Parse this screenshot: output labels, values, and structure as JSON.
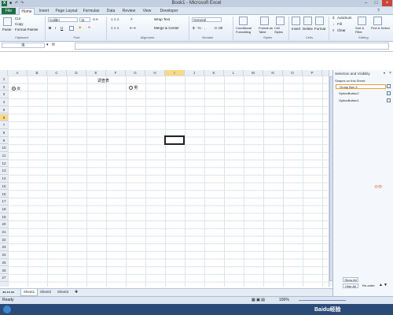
{
  "window": {
    "title": "Book1 - Microsoft Excel"
  },
  "tabs": [
    "File",
    "Home",
    "Insert",
    "Page Layout",
    "Formulas",
    "Data",
    "Review",
    "View",
    "Developer"
  ],
  "ribbon": {
    "clipboard": {
      "paste": "Paste",
      "cut": "Cut",
      "copy": "Copy",
      "format_painter": "Format Painter",
      "label": "Clipboard"
    },
    "font": {
      "name": "Calibri",
      "size": "11",
      "label": "Font"
    },
    "alignment": {
      "wrap": "Wrap Text",
      "merge": "Merge & Center",
      "label": "Alignment"
    },
    "number": {
      "format": "General",
      "label": "Number"
    },
    "styles": {
      "conditional": "Conditional Formatting",
      "table": "Format as Table",
      "cell_styles": "Cell Styles",
      "label": "Styles"
    },
    "cells": {
      "insert": "Insert",
      "delete": "Delete",
      "format": "Format",
      "label": "Cells"
    },
    "editing": {
      "autosum": "AutoSum",
      "fill": "Fill",
      "clear": "Clear",
      "sort": "Sort & Filter",
      "find": "Find & Select",
      "label": "Editing"
    }
  },
  "formula_bar": {
    "name_box": "I6",
    "fx": "fx",
    "value": ""
  },
  "columns": [
    "A",
    "B",
    "C",
    "D",
    "E",
    "F",
    "G",
    "H",
    "I",
    "J",
    "K",
    "L",
    "M",
    "N",
    "O",
    "P"
  ],
  "rows": [
    "1",
    "2",
    "3",
    "4",
    "5",
    "6",
    "7",
    "8",
    "9",
    "10",
    "11",
    "12",
    "13",
    "14",
    "15",
    "16",
    "17",
    "18",
    "19",
    "20",
    "21",
    "22",
    "23",
    "24",
    "25",
    "26",
    "27"
  ],
  "cells": {
    "title": "调查表",
    "option_female": "女",
    "option_male": "男"
  },
  "sheets": [
    "Sheet1",
    "Sheet2",
    "Sheet3"
  ],
  "status": {
    "ready": "Ready",
    "zoom": "100%"
  },
  "selection_pane": {
    "title": "Selection and Visibility",
    "subtitle": "Shapes on this Sheet:",
    "items": [
      "Group Box 3",
      "OptionButton2",
      "OptionButton1"
    ],
    "show_all": "Show All",
    "hide_all": "Hide All",
    "reorder": "Re-order"
  },
  "watermark": "Baidu经验"
}
